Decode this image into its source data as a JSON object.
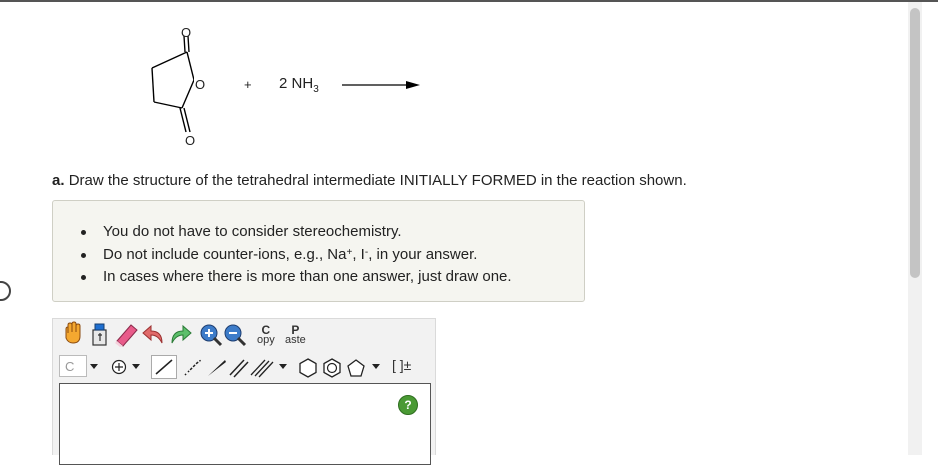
{
  "reaction": {
    "oxygen_label": "O",
    "plus": "+",
    "reagent_coeff": "2",
    "reagent_formula": "NH",
    "reagent_subscript": "3"
  },
  "question": {
    "part": "a.",
    "text": "Draw the structure of the tetrahedral intermediate INITIALLY FORMED in the reaction shown."
  },
  "hints": {
    "item1": "You do not have to consider stereochemistry.",
    "item2_pre": "Do not include counter-ions, e.g., Na",
    "item2_sup1": "+",
    "item2_mid": ", I",
    "item2_sup2": "-",
    "item2_post": ", in your answer.",
    "item3": "In cases where there is more than one answer, just draw one."
  },
  "editor": {
    "element_value": "C",
    "copy_top": "C",
    "copy_bottom": "opy",
    "paste_top": "P",
    "paste_bottom": "aste",
    "bracket_label": "[ ]±",
    "help_label": "?"
  }
}
